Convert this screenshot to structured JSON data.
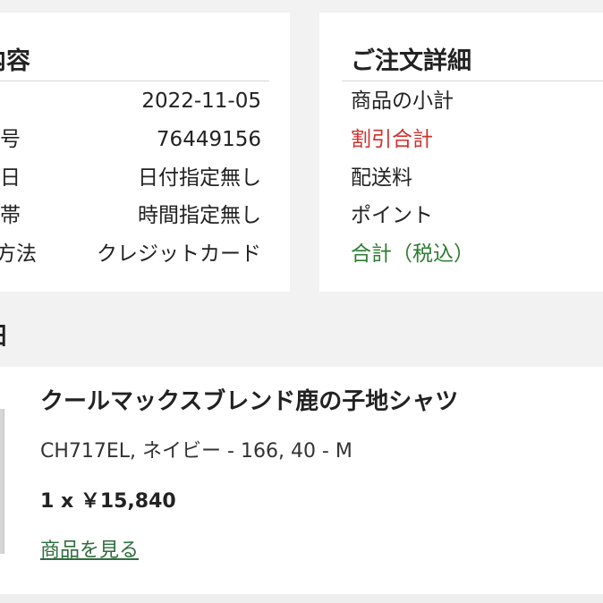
{
  "order_info": {
    "title": "内容",
    "rows": [
      {
        "label": "",
        "value": "2022-11-05"
      },
      {
        "label": "号",
        "value": "76449156"
      },
      {
        "label": "日",
        "value": "日付指定無し"
      },
      {
        "label": "帯",
        "value": "時間指定無し"
      },
      {
        "label": "方法",
        "value": "クレジットカード"
      }
    ]
  },
  "order_detail": {
    "title": "ご注文詳細",
    "rows": [
      {
        "label": "商品の小計",
        "color": "#222222"
      },
      {
        "label": "割引合計",
        "color": "#d0312d"
      },
      {
        "label": "配送料",
        "color": "#222222"
      },
      {
        "label": "ポイント",
        "color": "#222222"
      },
      {
        "label": "合計（税込）",
        "color": "#2e7d32"
      }
    ]
  },
  "items_section": {
    "title": "細"
  },
  "item": {
    "name": "クールマックスブレンド鹿の子地シャツ",
    "variant": "CH717EL, ネイビー - 166, 40 - M",
    "qty_price": "1 x ￥15,840",
    "view_link": "商品を見る",
    "link_color": "#2e6d3e"
  }
}
